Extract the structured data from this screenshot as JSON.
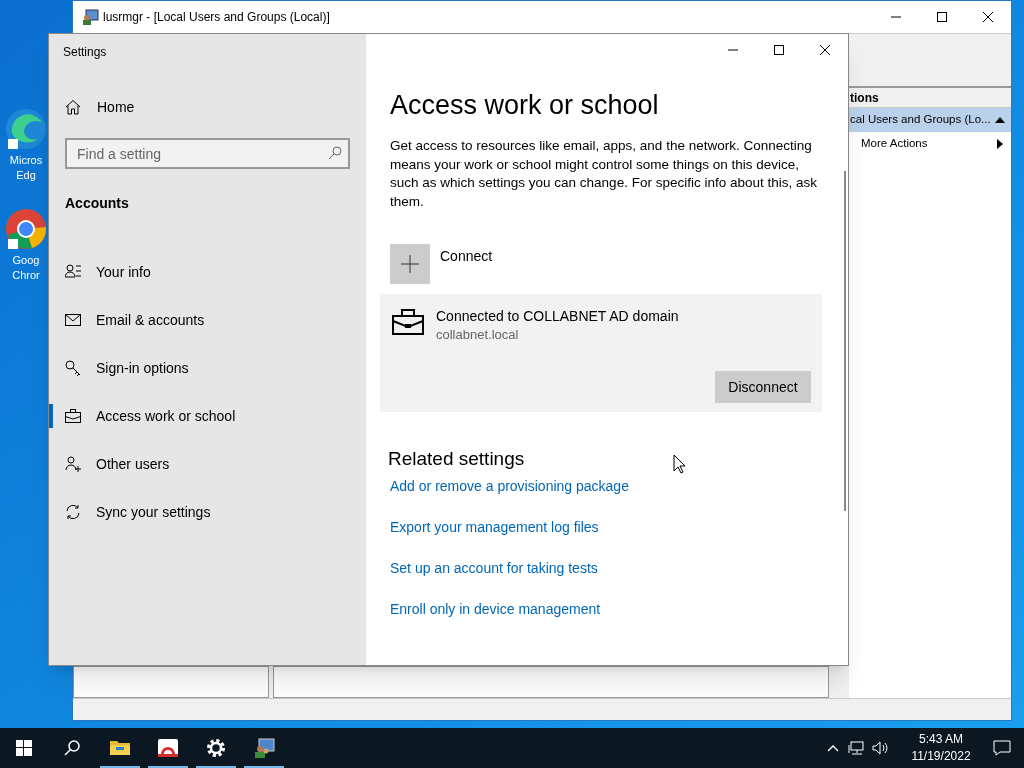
{
  "desktop_icons": [
    {
      "kind": "edge",
      "label_lines": [
        "Micros",
        "Edg"
      ]
    },
    {
      "kind": "chrome",
      "label_lines": [
        "Goog",
        "Chror"
      ]
    }
  ],
  "back_window": {
    "title": "lusrmgr - [Local Users and Groups (Local)]",
    "actions_header": "tions",
    "actions": [
      {
        "label": "cal Users and Groups (Lo...",
        "selected": true,
        "kind": "group"
      },
      {
        "label": "More Actions",
        "selected": false,
        "kind": "submenu"
      }
    ]
  },
  "settings": {
    "title": "Settings",
    "home": "Home",
    "search": {
      "placeholder": "Find a setting"
    },
    "section": "Accounts",
    "nav": [
      {
        "kind": "info",
        "label": "Your info",
        "selected": false
      },
      {
        "kind": "email",
        "label": "Email & accounts",
        "selected": false
      },
      {
        "kind": "signin",
        "label": "Sign-in options",
        "selected": false
      },
      {
        "kind": "work",
        "label": "Access work or school",
        "selected": true
      },
      {
        "kind": "users",
        "label": "Other users",
        "selected": false
      },
      {
        "kind": "sync",
        "label": "Sync your settings",
        "selected": false
      }
    ],
    "heading": "Access work or school",
    "description": "Get access to resources like email, apps, and the network. Connecting means your work or school might control some things on this device, such as which settings you can change. For specific info about this, ask them.",
    "connect": "Connect",
    "account": {
      "title": "Connected to COLLABNET AD domain",
      "subtitle": "collabnet.local",
      "button": "Disconnect"
    },
    "related_heading": "Related settings",
    "links": [
      "Add or remove a provisioning package",
      "Export your management log files",
      "Set up an account for taking tests",
      "Enroll only in device management"
    ]
  },
  "taskbar": {
    "apps": [
      {
        "kind": "folder",
        "running": true
      },
      {
        "kind": "red-app",
        "running": true
      },
      {
        "kind": "gear",
        "running": true
      },
      {
        "kind": "users",
        "running": true
      }
    ],
    "time": "5:43 AM",
    "date": "11/19/2022"
  }
}
